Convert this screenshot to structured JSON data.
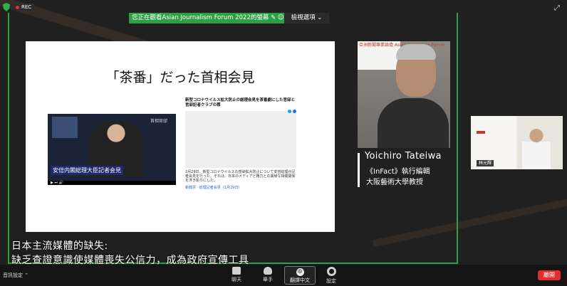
{
  "header": {
    "rec_label": "REC",
    "banner_text": "您正在觀看Asian Journalism Forum 2022的螢幕",
    "view_options_label": "檢視選項"
  },
  "slide": {
    "title": "「茶番」だった首相会見",
    "video_caption": "安倍内閣総理大臣記者会見",
    "video_logo": "首相官邸",
    "article_headline": "新型コロナウイルス拡大防止の総理会見を茶番劇にした官邸と官邸記者クラブの罪",
    "article_text": "2月29日、新型コロナウイルスの感染拡大防止について安倍総理が記者会見を行った。それは、日本のメディアと権力との異様な相関関係を浮き彫りにした。",
    "article_link": "新聞労 · 総理記者会見（1月29日）"
  },
  "speaker": {
    "logo_text": "亞洲新聞專業論壇 Asian Journalism Forum",
    "name": "Yoichiro Tateiwa",
    "title_line1": "《InFact》執行編輯",
    "title_line2": "大阪藝術大學教授"
  },
  "thumbnail": {
    "participant_name": "林元輝"
  },
  "subtitle": {
    "line1": "日本主流媒體的缺失:",
    "line2": "缺乏查證意識使媒體喪失公信力，成為政府宣傳工具"
  },
  "toolbar": {
    "audio_label": "音訊設定",
    "chat_label": "聊天",
    "raise_hand_label": "舉手",
    "interpretation_label": "翻譯中文",
    "interpretation_badge": "中",
    "settings_label": "設定",
    "leave_label": "離開"
  },
  "colors": {
    "share_green": "#2ea043",
    "leave_red": "#e02e2e"
  }
}
